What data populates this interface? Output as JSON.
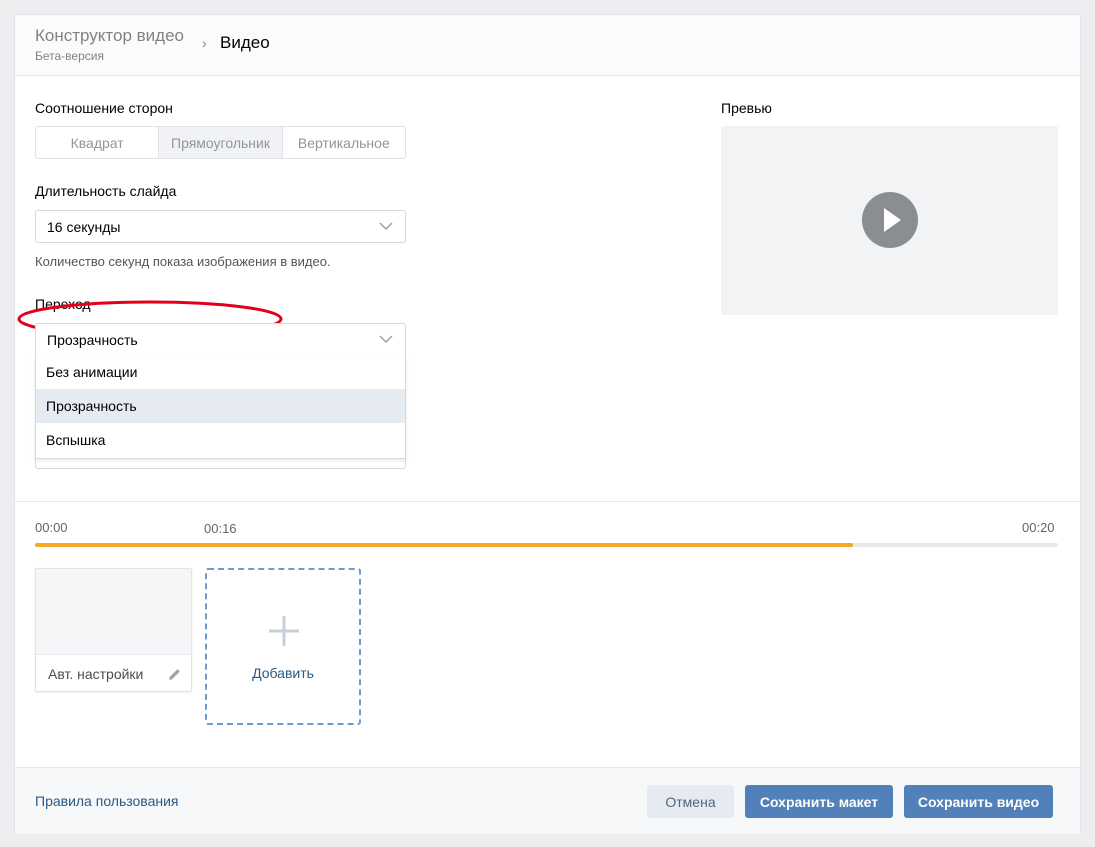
{
  "header": {
    "breadcrumb_parent": "Конструктор видео",
    "breadcrumb_sub": "Бета-версия",
    "separator": "›",
    "current": "Видео"
  },
  "aspect": {
    "label": "Соотношение сторон",
    "options": [
      "Квадрат",
      "Прямоугольник",
      "Вертикальное"
    ],
    "selected": "Прямоугольник"
  },
  "duration": {
    "label": "Длительность слайда",
    "value": "16 секунды",
    "hint": "Количество секунд показа изображения в видео."
  },
  "transition": {
    "label": "Переход",
    "value": "Прозрачность",
    "options": [
      "Без анимации",
      "Прозрачность",
      "Вспышка"
    ],
    "highlighted": "Прозрачность"
  },
  "preview": {
    "label": "Превью"
  },
  "timeline": {
    "start": "00:00",
    "marker": "00:16",
    "end": "00:20",
    "progress_fraction": 0.8
  },
  "slides": {
    "first_label": "Авт. настройки",
    "add_label": "Добавить"
  },
  "footer": {
    "rules_link": "Правила пользования",
    "cancel": "Отмена",
    "save_layout": "Сохранить макет",
    "save_video": "Сохранить видео"
  },
  "colors": {
    "accent": "#5181b8",
    "progress": "#f5a623",
    "annotation": "#e3001b",
    "link": "#2a5885"
  },
  "icons": {
    "dropdown": "chevron-down-icon",
    "play": "play-icon",
    "edit": "pencil-icon",
    "add": "plus-icon"
  }
}
